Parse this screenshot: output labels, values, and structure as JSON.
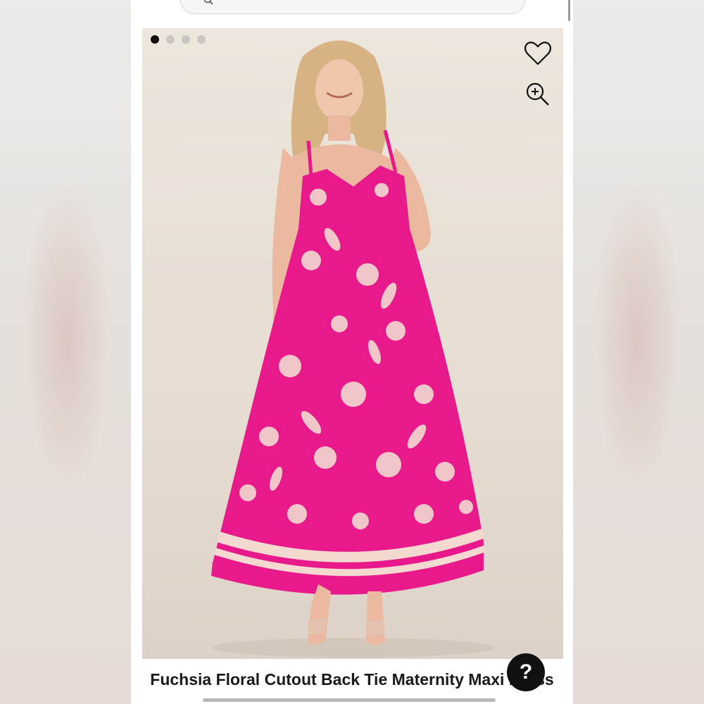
{
  "product": {
    "title": "Fuchsia Floral Cutout Back Tie Maternity Maxi Dress",
    "image_alt": "Model wearing fuchsia floral maxi dress",
    "gallery": {
      "total_images": 4,
      "active_index": 0
    }
  },
  "actions": {
    "favorite_icon": "heart-icon",
    "zoom_icon": "zoom-in-icon",
    "help_glyph": "?"
  },
  "colors": {
    "accent": "#e8198b",
    "dress_light": "#f3d9cf",
    "help_button": "#111111"
  }
}
